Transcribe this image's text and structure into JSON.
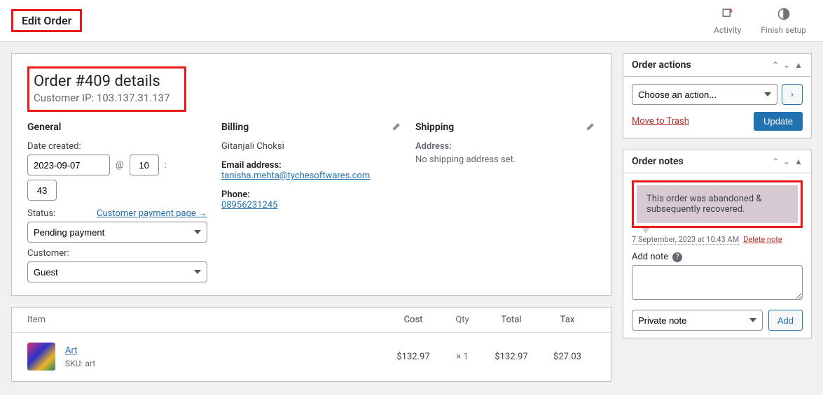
{
  "topbar": {
    "page_title": "Edit Order",
    "activity_label": "Activity",
    "finish_label": "Finish setup"
  },
  "order": {
    "heading": "Order #409 details",
    "customer_ip_label": "Customer IP: 103.137.31.137"
  },
  "general": {
    "title": "General",
    "date_label": "Date created:",
    "date_value": "2023-09-07",
    "hour_value": "10",
    "minute_value": "43",
    "at_symbol": "@",
    "colon_symbol": ":",
    "status_label": "Status:",
    "cpp_link": "Customer payment page →",
    "status_value": "Pending payment",
    "customer_label": "Customer:",
    "customer_value": "Guest"
  },
  "billing": {
    "title": "Billing",
    "name": "Gitanjali Choksi",
    "email_label": "Email address:",
    "email_value": "tanisha.mehta@tychesoftwares.com",
    "phone_label": "Phone:",
    "phone_value": "08956231245"
  },
  "shipping": {
    "title": "Shipping",
    "address_label": "Address:",
    "address_none": "No shipping address set."
  },
  "items": {
    "head_item": "Item",
    "head_cost": "Cost",
    "head_qty": "Qty",
    "head_total": "Total",
    "head_tax": "Tax",
    "row": {
      "name": "Art",
      "sku_label": "SKU:",
      "sku_value": "art",
      "cost": "$132.97",
      "qty": "× 1",
      "total": "$132.97",
      "tax": "$27.03"
    }
  },
  "actions": {
    "title": "Order actions",
    "choose": "Choose an action...",
    "trash": "Move to Trash",
    "update": "Update"
  },
  "notes": {
    "title": "Order notes",
    "bubble_text": "This order was abandoned & subsequently recovered.",
    "date": "7 September, 2023 at 10:43 AM",
    "delete": "Delete note",
    "add_label": "Add note",
    "type_value": "Private note",
    "add_btn": "Add"
  }
}
